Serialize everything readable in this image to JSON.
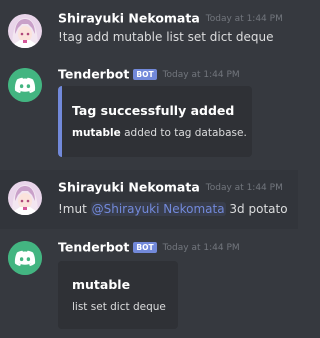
{
  "messages": [
    {
      "author": "Shirayuki Nekomata",
      "timestamp": "Today at 1:44 PM",
      "text": "!tag add mutable list set dict deque"
    },
    {
      "author": "Tenderbot",
      "bot_tag": "BOT",
      "timestamp": "Today at 1:44 PM",
      "embed": {
        "color": "#7289da",
        "title": "Tag successfully added",
        "desc_bold": "mutable",
        "desc_rest": " added to tag database."
      }
    },
    {
      "author": "Shirayuki Nekomata",
      "timestamp": "Today at 1:44 PM",
      "text_prefix": "!mut ",
      "mention": "@Shirayuki Nekomata",
      "text_suffix": " 3d potato"
    },
    {
      "author": "Tenderbot",
      "bot_tag": "BOT",
      "timestamp": "Today at 1:44 PM",
      "embed": {
        "color": "#2f3136",
        "title": "mutable",
        "description": "list set dict deque"
      }
    }
  ],
  "icons": {
    "user_avatar": "anime-girl-avatar-icon",
    "bot_avatar": "discord-logo-icon"
  },
  "colors": {
    "background": "#36393f",
    "highlight": "#32353b",
    "embed_bg": "#2f3136",
    "accent": "#7289da",
    "bot_avatar_bg": "#43b581"
  }
}
